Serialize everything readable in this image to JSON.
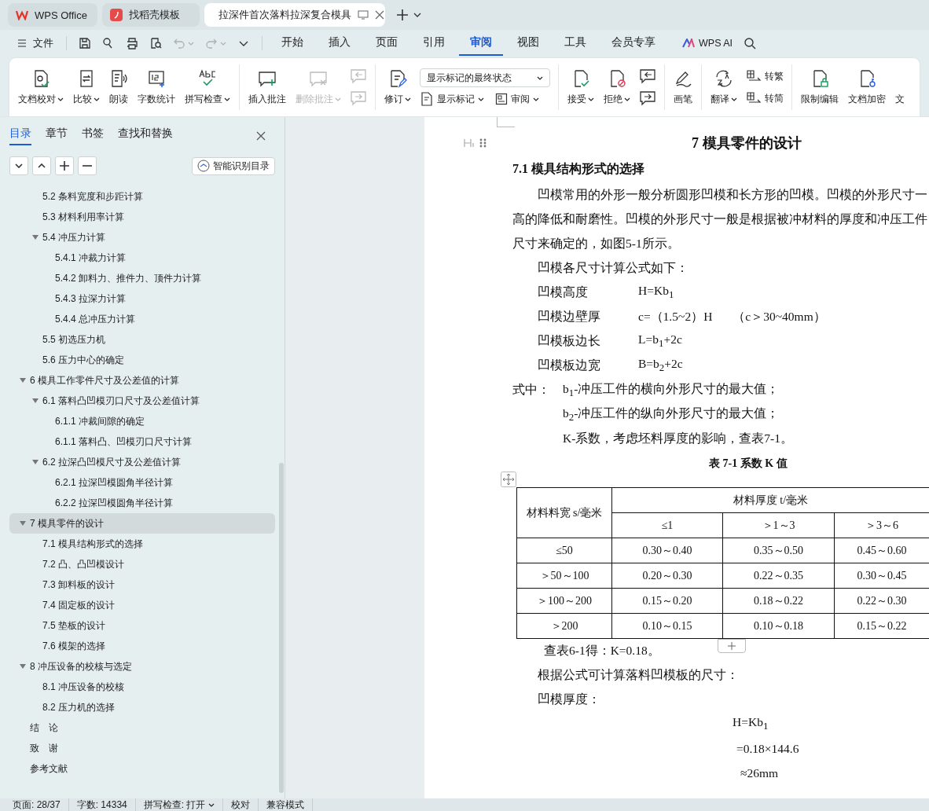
{
  "tabs": [
    {
      "label": "WPS Office",
      "kind": "home",
      "selected": false
    },
    {
      "label": "找稻壳模板",
      "kind": "docer",
      "selected": false
    },
    {
      "label": "拉深件首次落料拉深复合模具",
      "kind": "doc",
      "selected": true
    }
  ],
  "menu": {
    "file": "文件",
    "quick_access": [
      {
        "disabled": false,
        "dropdown": false
      },
      {
        "disabled": false,
        "dropdown": false
      },
      {
        "disabled": false,
        "dropdown": false
      },
      {
        "disabled": false,
        "dropdown": false
      },
      {
        "disabled": true,
        "dropdown": true
      },
      {
        "disabled": true,
        "dropdown": true
      },
      {
        "disabled": false,
        "dropdown": false
      }
    ],
    "tabs": [
      {
        "label": "开始",
        "selected": false
      },
      {
        "label": "插入",
        "selected": false
      },
      {
        "label": "页面",
        "selected": false
      },
      {
        "label": "引用",
        "selected": false
      },
      {
        "label": "审阅",
        "selected": true
      },
      {
        "label": "视图",
        "selected": false
      },
      {
        "label": "工具",
        "selected": false
      },
      {
        "label": "会员专享",
        "selected": false
      }
    ],
    "ai": "WPS AI"
  },
  "ribbon": [
    {
      "items": [
        {
          "kind": "large",
          "label": "文档校对",
          "dropdown": true,
          "disabled": false
        },
        {
          "kind": "large",
          "label": "比较",
          "dropdown": true,
          "disabled": false
        },
        {
          "kind": "large",
          "label": "朗读",
          "dropdown": false,
          "disabled": false
        },
        {
          "kind": "large",
          "label": "字数统计",
          "dropdown": false,
          "disabled": false
        },
        {
          "kind": "large",
          "label": "拼写检查",
          "dropdown": true,
          "disabled": false
        }
      ]
    },
    {
      "items": [
        {
          "kind": "large",
          "label": "插入批注",
          "dropdown": false,
          "disabled": false
        },
        {
          "kind": "large",
          "label": "删除批注",
          "dropdown": true,
          "disabled": true
        },
        {
          "kind": "stack",
          "items": [
            {
              "disabled": true
            },
            {
              "disabled": true
            }
          ]
        }
      ]
    },
    {
      "items": [
        {
          "kind": "large",
          "label": "修订",
          "dropdown": true,
          "disabled": false
        },
        {
          "kind": "select",
          "value": "显示标记的最终状态",
          "buttons": [
            {
              "label": "显示标记",
              "dropdown": true
            },
            {
              "label": "审阅",
              "dropdown": true
            }
          ]
        }
      ]
    },
    {
      "items": [
        {
          "kind": "large",
          "label": "接受",
          "dropdown": true,
          "disabled": false
        },
        {
          "kind": "large",
          "label": "拒绝",
          "dropdown": true,
          "disabled": false
        },
        {
          "kind": "stack",
          "items": [
            {
              "disabled": false
            },
            {
              "disabled": false
            }
          ]
        }
      ]
    },
    {
      "items": [
        {
          "kind": "large",
          "label": "画笔",
          "dropdown": false,
          "disabled": false
        }
      ]
    },
    {
      "items": [
        {
          "kind": "large",
          "label": "翻译",
          "dropdown": true,
          "disabled": false
        },
        {
          "kind": "pair",
          "buttons": [
            {
              "label": "转繁"
            },
            {
              "label": "转简"
            }
          ]
        }
      ]
    },
    {
      "items": [
        {
          "kind": "large",
          "label": "限制编辑",
          "dropdown": false,
          "disabled": false
        },
        {
          "kind": "large",
          "label": "文档加密",
          "dropdown": false,
          "disabled": false
        },
        {
          "kind": "large",
          "label": "文",
          "dropdown": false,
          "disabled": false
        }
      ]
    }
  ],
  "sidebar": {
    "tabs": [
      {
        "label": "目录",
        "selected": true
      },
      {
        "label": "章节",
        "selected": false
      },
      {
        "label": "书签",
        "selected": false
      },
      {
        "label": "查找和替换",
        "selected": false
      }
    ],
    "smart_button": "智能识别目录",
    "continued": [
      {
        "label": "5.2  条料宽度和步距计算",
        "selected": false
      },
      {
        "label": "5.3  材料利用率计算",
        "selected": false
      },
      {
        "label": "5.4  冲压力计算",
        "selected": false,
        "expanded": true,
        "children": [
          {
            "label": "5.4.1 冲裁力计算",
            "selected": false
          },
          {
            "label": "5.4.2 卸料力、推件力、顶件力计算",
            "selected": false
          },
          {
            "label": "5.4.3 拉深力计算",
            "selected": false
          },
          {
            "label": "5.4.4 总冲压力计算",
            "selected": false
          }
        ]
      },
      {
        "label": "5.5  初选压力机",
        "selected": false
      },
      {
        "label": "5.6 压力中心的确定",
        "selected": false
      }
    ],
    "items": [
      {
        "label": "6  模具工作零件尺寸及公差值的计算",
        "selected": false,
        "expanded": true,
        "children": [
          {
            "label": "6.1 落料凸凹模刃口尺寸及公差值计算",
            "selected": false,
            "expanded": true,
            "children": [
              {
                "label": "6.1.1 冲裁间隙的确定",
                "selected": false
              },
              {
                "label": "6.1.1 落料凸、凹模刃口尺寸计算",
                "selected": false
              }
            ]
          },
          {
            "label": "6.2 拉深凸凹模尺寸及公差值计算",
            "selected": false,
            "expanded": true,
            "children": [
              {
                "label": "6.2.1 拉深凹模圆角半径计算",
                "selected": false
              },
              {
                "label": "6.2.2 拉深凹模圆角半径计算",
                "selected": false
              }
            ]
          }
        ]
      },
      {
        "label": "7  模具零件的设计",
        "selected": true,
        "expanded": true,
        "children": [
          {
            "label": "7.1  模具结构形式的选择",
            "selected": false
          },
          {
            "label": "7.2  凸、凸凹模设计",
            "selected": false
          },
          {
            "label": "7.3  卸料板的设计",
            "selected": false
          },
          {
            "label": "7.4  固定板的设计",
            "selected": false
          },
          {
            "label": "7.5  垫板的设计",
            "selected": false
          },
          {
            "label": "7.6  模架的选择",
            "selected": false
          }
        ]
      },
      {
        "label": "8  冲压设备的校核与选定",
        "selected": false,
        "expanded": true,
        "children": [
          {
            "label": "8.1  冲压设备的校核",
            "selected": false
          },
          {
            "label": "8.2 压力机的选择",
            "selected": false
          }
        ]
      },
      {
        "label": "结　论",
        "selected": false
      },
      {
        "label": "致　谢",
        "selected": false
      },
      {
        "label": "参考文献",
        "selected": false
      }
    ]
  },
  "document": {
    "chapter_title": "7  模具零件的设计",
    "section_title": "7.1  模具结构形式的选择",
    "paragraph_lines": [
      "凹模常用的外形一般分析圆形凹模和长方形的凹模。凹模的外形尺寸一",
      "高的降低和耐磨性。凹模的外形尺寸一般是根据被冲材料的厚度和冲压工件",
      "尺寸来确定的，如图5-1所示。"
    ],
    "formula_intro": "凹模各尺寸计算公式如下：",
    "formulas": [
      {
        "label": "凹模高度",
        "formula": "H=Kb$_{1}$"
      },
      {
        "label": "凹模边壁厚",
        "formula": "c=（1.5~2）H",
        "note": "（c＞30~40mm）"
      },
      {
        "label": "凹模板边长",
        "formula": "L=b$_{1}$+2c"
      },
      {
        "label": "凹模板边宽",
        "formula": "B=b$_{2}$+2c"
      }
    ],
    "where_label": "式中：",
    "where_items": [
      "b$_{1}$-冲压工件的横向外形尺寸的最大值；",
      "b$_{2}$-冲压工件的纵向外形尺寸的最大值；",
      "K-系数，考虑坯料厚度的影响，查表7-1。"
    ],
    "table_caption": "表 7-1  系数 K 值",
    "table": {
      "header_rows": [
        [
          {
            "text": "材料料宽 s/毫米",
            "rowspan": 2
          },
          {
            "text": "材料厚度 t/毫米",
            "colspan": 3
          }
        ],
        [
          {
            "text": "≤1"
          },
          {
            "text": "＞1～3"
          },
          {
            "text": "＞3～6"
          }
        ]
      ],
      "rows": [
        [
          "≤50",
          "0.30～0.40",
          "0.35～0.50",
          "0.45～0.60"
        ],
        [
          "＞50～100",
          "0.20～0.30",
          "0.22～0.35",
          "0.30～0.45"
        ],
        [
          "＞100～200",
          "0.15～0.20",
          "0.18～0.22",
          "0.22～0.30"
        ],
        [
          "＞200",
          "0.10～0.15",
          "0.10～0.18",
          "0.15～0.22"
        ]
      ]
    },
    "after_lines": [
      "查表6-1得：K=0.18。",
      "根据公式可计算落料凹模板的尺寸：",
      "凹模厚度："
    ],
    "calc_lines": [
      "H=Kb$_{1}$",
      "=0.18×144.6",
      "≈26mm"
    ]
  },
  "status_bar": [
    {
      "label": "页面: 28/37",
      "dropdown": false
    },
    {
      "label": "字数: 14334",
      "dropdown": false
    },
    {
      "label": "拼写检查: 打开",
      "dropdown": true
    },
    {
      "label": "校对",
      "dropdown": false
    },
    {
      "label": "兼容模式",
      "dropdown": false
    }
  ]
}
